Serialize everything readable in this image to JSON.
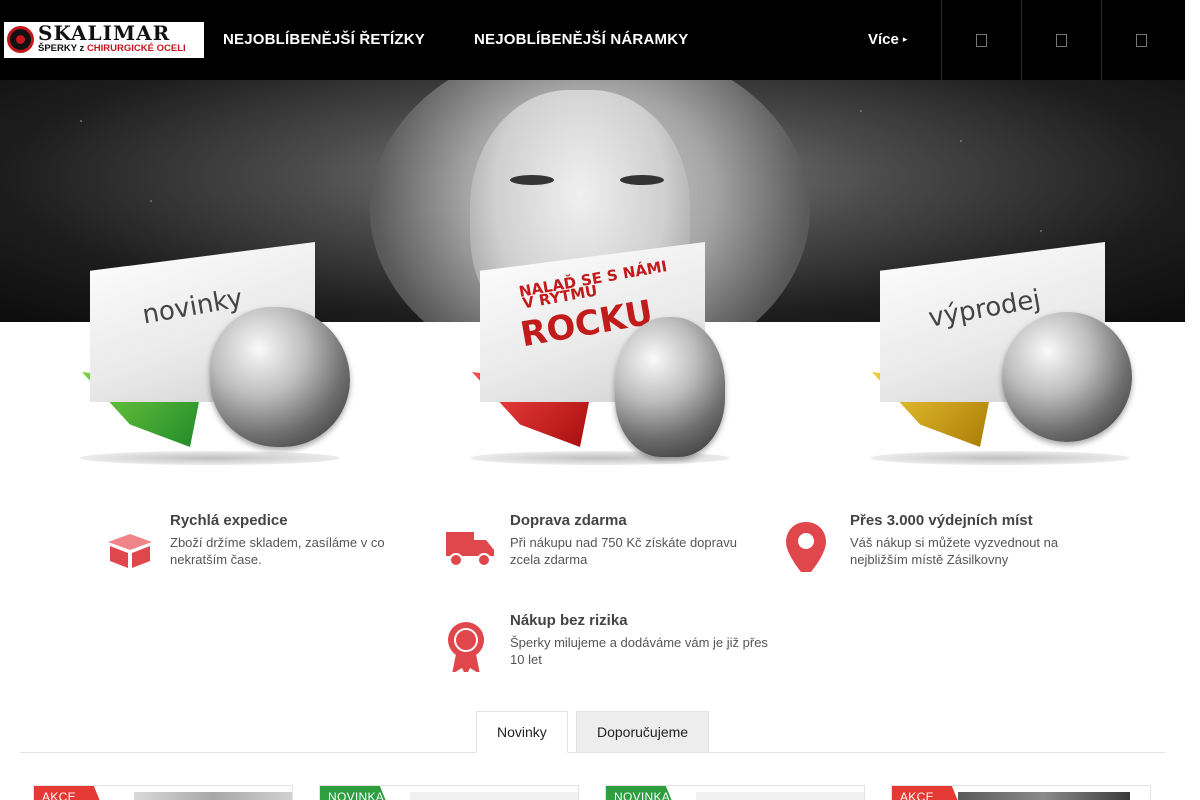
{
  "header": {
    "logo": {
      "brand": "SKALIMAR",
      "tagline_prefix": "ŠPERKY z ",
      "tagline_highlight": "CHIRURGICKÉ OCELI"
    },
    "nav": [
      {
        "label": "NEJOBLÍBENĚJŠÍ ŘETÍZKY"
      },
      {
        "label": "NEJOBLÍBENĚJŠÍ NÁRAMKY"
      }
    ],
    "more_label": "Více",
    "more_caret": "▸",
    "buttons": [
      {
        "icon": "search-icon"
      },
      {
        "icon": "user-icon"
      },
      {
        "icon": "cart-icon"
      }
    ]
  },
  "banners": [
    {
      "key": "novinky",
      "line1": "novinky",
      "color": "#3aa13a"
    },
    {
      "key": "rock",
      "line1": "NALAĎ SE S NÁMI",
      "line2": "V RYTMU",
      "line3": "ROCKU",
      "color": "#d41f1f"
    },
    {
      "key": "vyprodej",
      "line1": "výprodej",
      "color": "#d8a414"
    }
  ],
  "features": [
    {
      "icon": "box-icon",
      "title": "Rychlá expedice",
      "desc": "Zboží držíme skladem, zasíláme v co nekratším čase."
    },
    {
      "icon": "truck-icon",
      "title": "Doprava zdarma",
      "desc": "Při nákupu nad 750 Kč získáte dopravu zcela zdarma"
    },
    {
      "icon": "pin-icon",
      "title": "Přes 3.000 výdejních míst",
      "desc": "Váš nákup si můžete vyzvednout na nejbližším místě Zásilkovny"
    },
    {
      "icon": "award-icon",
      "title": "Nákup bez rizika",
      "desc": "Šperky milujeme a dodáváme vám je již přes 10 let"
    }
  ],
  "feature_icon_color": "#e0474c",
  "tabs": [
    {
      "label": "Novinky",
      "active": true
    },
    {
      "label": "Doporučujeme",
      "active": false
    }
  ],
  "products": [
    {
      "flag": "AKCE",
      "flag_color": "red"
    },
    {
      "flag": "NOVINKA",
      "flag_color": "green"
    },
    {
      "flag": "NOVINKA",
      "flag_color": "green"
    },
    {
      "flag": "AKCE",
      "flag_color": "red"
    }
  ]
}
